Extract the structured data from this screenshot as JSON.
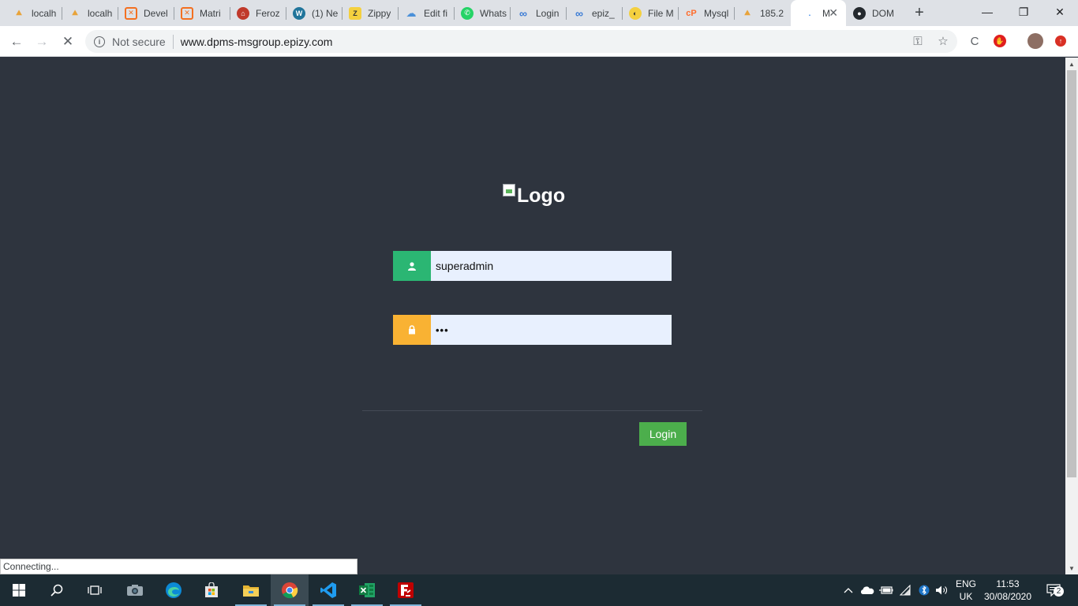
{
  "browser": {
    "tabs": [
      {
        "title": "localh",
        "icon": "phpmyadmin-icon"
      },
      {
        "title": "localh",
        "icon": "phpmyadmin-icon"
      },
      {
        "title": "Devel",
        "icon": "xampp-icon"
      },
      {
        "title": "Matri",
        "icon": "xampp-icon"
      },
      {
        "title": "Feroz",
        "icon": "home-icon"
      },
      {
        "title": "(1) Ne",
        "icon": "wordpress-icon"
      },
      {
        "title": "Zippy",
        "icon": "zippy-icon"
      },
      {
        "title": "Edit fi",
        "icon": "cloud-icon"
      },
      {
        "title": "Whats",
        "icon": "whatsapp-icon"
      },
      {
        "title": "Login",
        "icon": "infinity-icon"
      },
      {
        "title": "epiz_",
        "icon": "infinity-icon"
      },
      {
        "title": "File M",
        "icon": "filemanager-icon"
      },
      {
        "title": "Mysql",
        "icon": "cpanel-icon"
      },
      {
        "title": "185.2",
        "icon": "phpmyadmin-icon"
      },
      {
        "title": "M",
        "icon": "loading-icon",
        "active": true
      },
      {
        "title": "DOM",
        "icon": "github-icon"
      }
    ],
    "address": {
      "security_label": "Not secure",
      "url": "www.dpms-msgroup.epizy.com"
    },
    "status_text": "Connecting..."
  },
  "page": {
    "logo_alt": "Logo",
    "username_value": "superadmin",
    "password_value": "•••",
    "login_label": "Login",
    "colors": {
      "background": "#2e343e",
      "user_addon": "#2bb673",
      "pass_addon": "#f9b233",
      "button": "#4cae4c",
      "input_bg": "#e8f0fe"
    }
  },
  "taskbar": {
    "language": "ENG",
    "region": "UK",
    "time": "11:53",
    "date": "30/08/2020",
    "notifications": "2"
  }
}
